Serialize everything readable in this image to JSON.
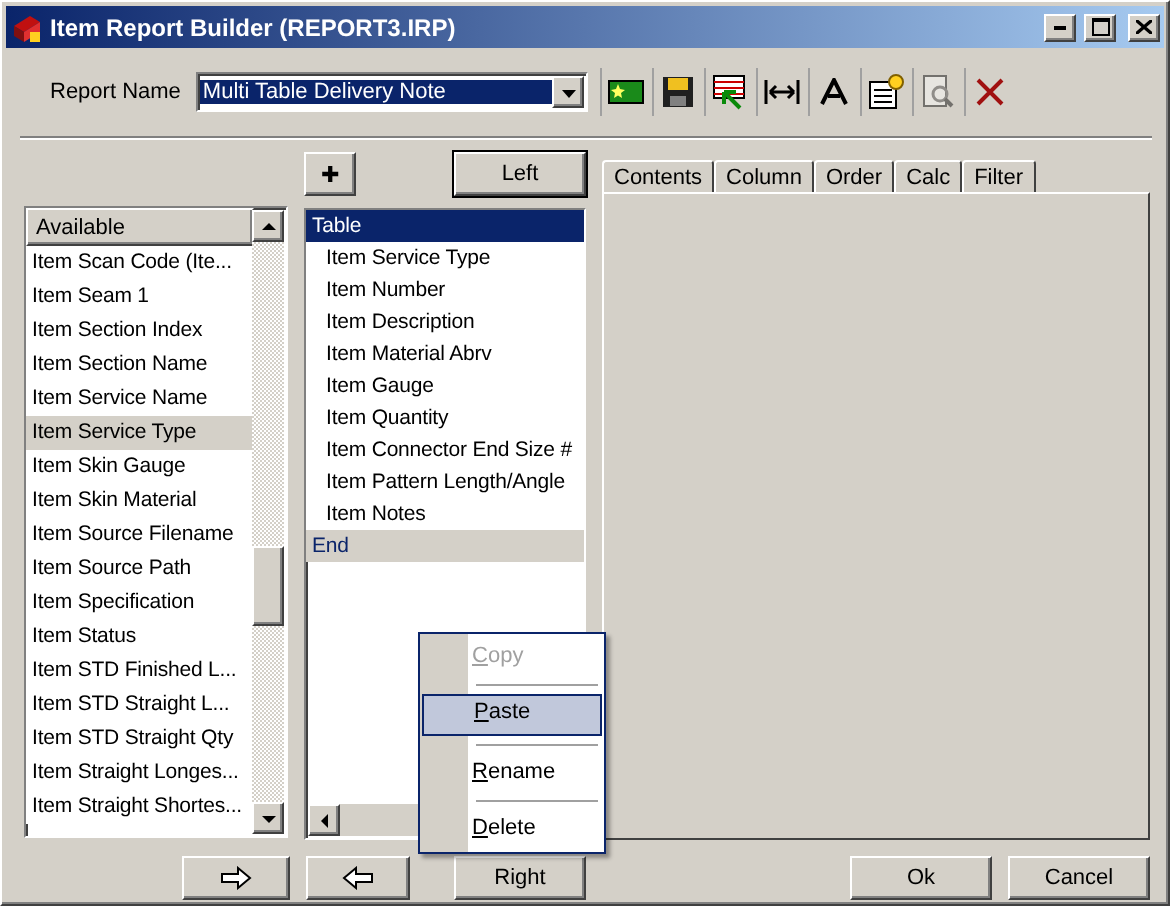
{
  "window": {
    "title": "Item Report Builder (REPORT3.IRP)"
  },
  "report_name": {
    "label": "Report Name",
    "value": "Multi Table Delivery Note"
  },
  "toolbar": [
    {
      "kind": "new",
      "disabled": false
    },
    {
      "kind": "save",
      "disabled": false
    },
    {
      "kind": "grid",
      "disabled": false
    },
    {
      "kind": "width",
      "disabled": false
    },
    {
      "kind": "font",
      "disabled": false
    },
    {
      "kind": "properties",
      "disabled": false
    },
    {
      "kind": "preview",
      "disabled": true
    },
    {
      "kind": "delete",
      "disabled": false
    }
  ],
  "add_button": "✚",
  "left_button": "Left",
  "available": {
    "header": "Available",
    "items": [
      {
        "label": "Item Scan Code (Ite...",
        "selected": false
      },
      {
        "label": "Item Seam 1",
        "selected": false
      },
      {
        "label": "Item Section Index",
        "selected": false
      },
      {
        "label": "Item Section Name",
        "selected": false
      },
      {
        "label": "Item Service Name",
        "selected": false
      },
      {
        "label": "Item Service Type",
        "selected": true
      },
      {
        "label": "Item Skin Gauge",
        "selected": false
      },
      {
        "label": "Item Skin Material",
        "selected": false
      },
      {
        "label": "Item Source Filename",
        "selected": false
      },
      {
        "label": "Item Source Path",
        "selected": false
      },
      {
        "label": "Item Specification",
        "selected": false
      },
      {
        "label": "Item Status",
        "selected": false
      },
      {
        "label": "Item STD Finished L...",
        "selected": false
      },
      {
        "label": "Item STD Straight L...",
        "selected": false
      },
      {
        "label": "Item STD Straight Qty",
        "selected": false
      },
      {
        "label": "Item Straight Longes...",
        "selected": false
      },
      {
        "label": "Item Straight Shortes...",
        "selected": false
      }
    ]
  },
  "layout": [
    {
      "label": "Table",
      "kind": "marker",
      "selected": true,
      "highlighted": false
    },
    {
      "label": "Item Service Type",
      "kind": "field",
      "selected": false,
      "highlighted": false
    },
    {
      "label": "Item Number",
      "kind": "field",
      "selected": false,
      "highlighted": false
    },
    {
      "label": "Item Description",
      "kind": "field",
      "selected": false,
      "highlighted": false
    },
    {
      "label": "Item Material Abrv",
      "kind": "field",
      "selected": false,
      "highlighted": false
    },
    {
      "label": "Item Gauge",
      "kind": "field",
      "selected": false,
      "highlighted": false
    },
    {
      "label": "Item Quantity",
      "kind": "field",
      "selected": false,
      "highlighted": false
    },
    {
      "label": "Item Connector End Size #",
      "kind": "field",
      "selected": false,
      "highlighted": false
    },
    {
      "label": "Item Pattern Length/Angle",
      "kind": "field",
      "selected": false,
      "highlighted": false
    },
    {
      "label": "Item Notes",
      "kind": "field",
      "selected": false,
      "highlighted": false
    },
    {
      "label": "End",
      "kind": "marker",
      "selected": false,
      "highlighted": true
    }
  ],
  "tabs": [
    {
      "label": "Contents",
      "selected": false
    },
    {
      "label": "Column",
      "selected": false
    },
    {
      "label": "Order",
      "selected": false
    },
    {
      "label": "Calc",
      "selected": false
    },
    {
      "label": "Filter",
      "selected": false
    }
  ],
  "bottom_buttons": [
    {
      "kind": "right-arrow"
    },
    {
      "kind": "left-arrow"
    },
    {
      "kind": "text",
      "label": "Right"
    }
  ],
  "dialog_buttons": [
    "Ok",
    "Cancel"
  ],
  "context_menu": [
    {
      "label": "Copy",
      "disabled": true,
      "selected": false
    },
    {
      "label": "Paste",
      "disabled": false,
      "selected": true
    },
    {
      "label": "Rename",
      "disabled": false,
      "selected": false
    },
    {
      "label": "Delete",
      "disabled": false,
      "selected": false
    }
  ]
}
